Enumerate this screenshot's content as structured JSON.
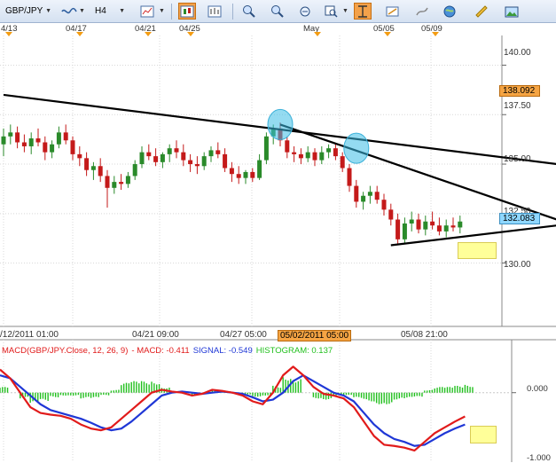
{
  "toolbar": {
    "symbol": "GBP/JPY",
    "timeframe": "H4",
    "buttons": [
      "chart-style",
      "bar-chart",
      "candlestick-chart",
      "zoom-in",
      "zoom-out",
      "magnifier",
      "crosshair",
      "draw-line",
      "pen-tool",
      "globe",
      "ruler",
      "picture"
    ]
  },
  "date_axis": {
    "labels": [
      "4/13",
      "04/17",
      "04/21",
      "04/25",
      "May",
      "05/05",
      "05/09"
    ]
  },
  "price_axis": {
    "labels": [
      "140.00",
      "137.50",
      "135.00",
      "132.50",
      "130.00"
    ],
    "tag_upper": "138.092",
    "tag_current": "132.083"
  },
  "time_axis": {
    "labels": [
      "/12/2011 01:00",
      "04/21 09:00",
      "04/27 05:00",
      "05/02/2011 05:00",
      "05/08 21:00"
    ]
  },
  "indicator": {
    "title": "MACD(GBP/JPY.Close, 12, 26, 9)",
    "macd": "- MACD: -0.411",
    "signal": "SIGNAL: -0.549",
    "histogram": "HISTOGRAM: 0.137",
    "axis_zero": "0.000",
    "axis_low": "-1.000",
    "colors": {
      "macd": "#e11b1b",
      "signal": "#1f37d6",
      "histogram": "#22c01e"
    }
  },
  "chart_data": [
    {
      "type": "candlestick",
      "title": "",
      "ylim": [
        126.8,
        141.5
      ],
      "candles": [
        [
          136.0,
          136.8,
          135.4,
          136.4
        ],
        [
          136.4,
          137.0,
          136.0,
          136.6
        ],
        [
          136.6,
          136.9,
          135.8,
          136.1
        ],
        [
          136.1,
          136.5,
          135.6,
          135.9
        ],
        [
          135.9,
          136.6,
          135.5,
          136.3
        ],
        [
          136.3,
          136.8,
          135.9,
          136.1
        ],
        [
          136.1,
          136.4,
          135.2,
          135.6
        ],
        [
          135.6,
          136.2,
          135.3,
          136.0
        ],
        [
          136.0,
          136.9,
          135.8,
          136.6
        ],
        [
          136.6,
          137.0,
          136.0,
          136.2
        ],
        [
          136.2,
          136.4,
          135.2,
          135.5
        ],
        [
          135.5,
          135.9,
          134.9,
          135.3
        ],
        [
          135.3,
          135.6,
          134.4,
          134.7
        ],
        [
          134.7,
          135.1,
          134.2,
          134.9
        ],
        [
          134.9,
          135.3,
          134.1,
          134.4
        ],
        [
          134.4,
          134.7,
          132.8,
          133.8
        ],
        [
          133.8,
          134.4,
          133.5,
          134.1
        ],
        [
          134.1,
          134.5,
          133.7,
          134.0
        ],
        [
          134.0,
          134.6,
          133.8,
          134.4
        ],
        [
          134.4,
          135.2,
          134.2,
          135.0
        ],
        [
          135.0,
          135.9,
          134.8,
          135.6
        ],
        [
          135.6,
          136.0,
          135.2,
          135.4
        ],
        [
          135.4,
          135.8,
          134.9,
          135.1
        ],
        [
          135.1,
          135.6,
          134.8,
          135.5
        ],
        [
          135.5,
          136.0,
          135.1,
          135.8
        ],
        [
          135.8,
          136.2,
          135.3,
          135.6
        ],
        [
          135.6,
          136.0,
          134.9,
          135.2
        ],
        [
          135.2,
          135.5,
          134.6,
          135.0
        ],
        [
          135.0,
          135.4,
          134.5,
          134.9
        ],
        [
          134.9,
          135.6,
          134.7,
          135.4
        ],
        [
          135.4,
          135.9,
          135.1,
          135.7
        ],
        [
          135.7,
          136.1,
          135.3,
          135.5
        ],
        [
          135.5,
          135.8,
          134.6,
          134.8
        ],
        [
          134.8,
          135.1,
          134.1,
          134.5
        ],
        [
          134.5,
          134.9,
          134.0,
          134.3
        ],
        [
          134.3,
          134.7,
          134.0,
          134.6
        ],
        [
          134.6,
          134.8,
          134.1,
          134.3
        ],
        [
          134.3,
          135.5,
          134.2,
          135.2
        ],
        [
          135.2,
          136.6,
          135.0,
          136.4
        ],
        [
          136.4,
          137.0,
          136.0,
          136.8
        ],
        [
          136.8,
          137.1,
          135.9,
          136.2
        ],
        [
          136.2,
          136.4,
          135.3,
          135.6
        ],
        [
          135.6,
          135.9,
          135.1,
          135.5
        ],
        [
          135.5,
          135.8,
          135.0,
          135.3
        ],
        [
          135.3,
          135.9,
          135.1,
          135.6
        ],
        [
          135.6,
          135.8,
          134.9,
          135.2
        ],
        [
          135.2,
          135.9,
          135.0,
          135.6
        ],
        [
          135.6,
          136.0,
          135.3,
          135.8
        ],
        [
          135.8,
          136.0,
          135.2,
          135.4
        ],
        [
          135.4,
          135.6,
          134.6,
          134.8
        ],
        [
          134.8,
          135.0,
          133.6,
          133.9
        ],
        [
          133.9,
          134.2,
          132.8,
          133.1
        ],
        [
          133.1,
          133.6,
          132.7,
          133.4
        ],
        [
          133.4,
          133.9,
          133.0,
          133.6
        ],
        [
          133.6,
          133.9,
          133.0,
          133.2
        ],
        [
          133.2,
          133.5,
          132.4,
          132.7
        ],
        [
          132.7,
          133.0,
          131.9,
          132.2
        ],
        [
          132.2,
          132.5,
          130.9,
          131.2
        ],
        [
          131.2,
          132.3,
          131.0,
          132.0
        ],
        [
          132.0,
          132.6,
          131.6,
          132.2
        ],
        [
          132.2,
          132.5,
          131.5,
          131.7
        ],
        [
          131.7,
          132.4,
          131.4,
          132.1
        ],
        [
          132.1,
          132.6,
          131.7,
          131.9
        ],
        [
          131.9,
          132.3,
          131.4,
          131.6
        ],
        [
          131.6,
          132.2,
          131.3,
          131.9
        ],
        [
          131.9,
          132.3,
          131.6,
          131.8
        ],
        [
          131.8,
          132.4,
          131.5,
          132.1
        ]
      ],
      "trendlines": [
        {
          "name": "upper-resistance",
          "from": [
            0,
            138.5
          ],
          "to": [
            80,
            135.0
          ]
        },
        {
          "name": "steep-resistance",
          "from": [
            40,
            137.0
          ],
          "to": [
            80,
            132.2
          ]
        },
        {
          "name": "support",
          "from": [
            56,
            130.9
          ],
          "to": [
            80,
            131.9
          ]
        }
      ],
      "touch_points": [
        [
          40,
          137.0
        ],
        [
          51,
          135.8
        ]
      ],
      "current_price": 132.083,
      "upper_price": 138.092
    },
    {
      "type": "macd",
      "title": "MACD(GBP/JPY.Close, 12, 26, 9)",
      "ylim": [
        -1.2,
        0.9
      ],
      "macd": [
        0.4,
        0.25,
        0.0,
        -0.25,
        -0.35,
        -0.38,
        -0.4,
        -0.45,
        -0.55,
        -0.62,
        -0.65,
        -0.6,
        -0.45,
        -0.3,
        -0.15,
        0.0,
        0.05,
        0.02,
        0.0,
        -0.05,
        -0.02,
        0.05,
        0.03,
        0.0,
        -0.05,
        -0.15,
        -0.2,
        0.0,
        0.3,
        0.45,
        0.3,
        0.1,
        -0.02,
        -0.05,
        -0.1,
        -0.25,
        -0.5,
        -0.75,
        -0.9,
        -0.92,
        -0.95,
        -1.0,
        -0.85,
        -0.7,
        -0.6,
        -0.5,
        -0.41
      ],
      "signal": [
        0.3,
        0.25,
        0.1,
        -0.05,
        -0.2,
        -0.3,
        -0.35,
        -0.4,
        -0.45,
        -0.52,
        -0.6,
        -0.65,
        -0.62,
        -0.5,
        -0.35,
        -0.2,
        -0.05,
        0.0,
        0.02,
        0.0,
        -0.02,
        0.0,
        0.02,
        0.0,
        -0.02,
        -0.08,
        -0.15,
        -0.12,
        0.0,
        0.2,
        0.3,
        0.2,
        0.1,
        0.0,
        -0.05,
        -0.15,
        -0.35,
        -0.55,
        -0.7,
        -0.8,
        -0.85,
        -0.92,
        -0.9,
        -0.8,
        -0.7,
        -0.62,
        -0.55
      ],
      "histogram": [
        0.1,
        0.0,
        -0.1,
        -0.2,
        -0.15,
        -0.08,
        -0.05,
        -0.05,
        -0.1,
        -0.1,
        -0.05,
        0.05,
        0.17,
        0.2,
        0.2,
        0.2,
        0.1,
        0.02,
        0.0,
        -0.05,
        0.0,
        0.05,
        0.01,
        0.0,
        -0.03,
        -0.07,
        -0.05,
        0.12,
        0.3,
        0.25,
        0.0,
        -0.1,
        -0.12,
        -0.05,
        -0.05,
        -0.1,
        -0.15,
        -0.2,
        -0.2,
        -0.12,
        -0.1,
        -0.08,
        0.05,
        0.1,
        0.1,
        0.12,
        0.137
      ]
    }
  ]
}
